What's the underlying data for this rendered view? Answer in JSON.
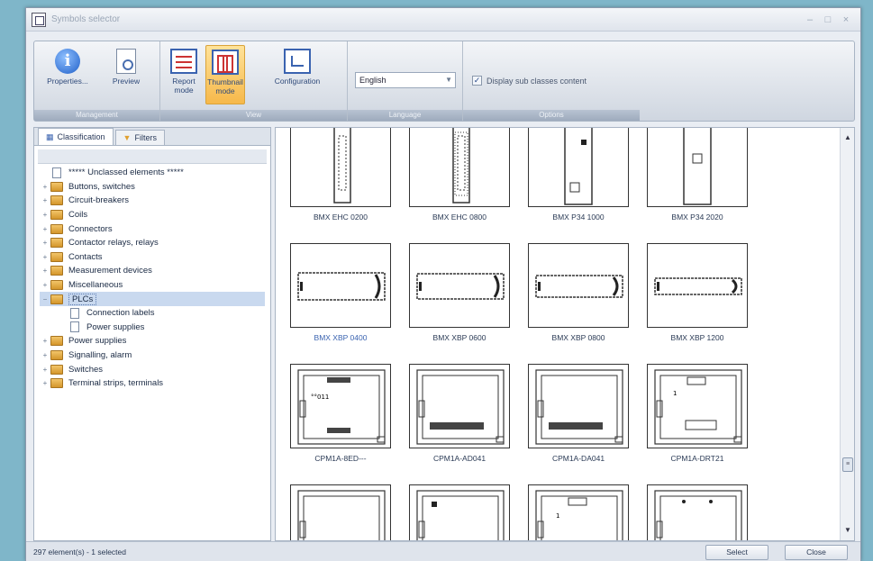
{
  "window": {
    "title": "Symbols selector"
  },
  "ribbon": {
    "buttons": [
      {
        "label": "Properties...",
        "icon": "info-icon"
      },
      {
        "label": "Preview",
        "icon": "preview-icon"
      },
      {
        "label": "Report mode",
        "icon": "report-mode-icon"
      },
      {
        "label": "Thumbnail mode",
        "icon": "thumbnail-mode-icon",
        "active": true
      },
      {
        "label": "Configuration",
        "icon": "configuration-icon"
      }
    ],
    "groups": [
      "Management",
      "View",
      "Language",
      "Options"
    ],
    "language": "English",
    "option_label": "Display sub classes content",
    "option_checked": true
  },
  "tabs": [
    "Classification",
    "Filters"
  ],
  "tree": [
    {
      "label": "***** Unclassed elements *****",
      "type": "doc"
    },
    {
      "label": "Buttons, switches",
      "type": "folder"
    },
    {
      "label": "Circuit-breakers",
      "type": "folder"
    },
    {
      "label": "Coils",
      "type": "folder"
    },
    {
      "label": "Connectors",
      "type": "folder"
    },
    {
      "label": "Contactor relays, relays",
      "type": "folder"
    },
    {
      "label": "Contacts",
      "type": "folder"
    },
    {
      "label": "Measurement devices",
      "type": "folder"
    },
    {
      "label": "Miscellaneous",
      "type": "folder"
    },
    {
      "label": "PLCs",
      "type": "folder",
      "expanded": true,
      "selected": true
    },
    {
      "label": "Connection labels",
      "type": "child"
    },
    {
      "label": "Power supplies",
      "type": "child"
    },
    {
      "label": "Power supplies",
      "type": "folder"
    },
    {
      "label": "Signalling, alarm",
      "type": "folder"
    },
    {
      "label": "Switches",
      "type": "folder"
    },
    {
      "label": "Terminal strips, terminals",
      "type": "folder"
    }
  ],
  "thumbnails": [
    {
      "label": "BMX EHC 0200"
    },
    {
      "label": "BMX EHC 0800"
    },
    {
      "label": "BMX P34 1000"
    },
    {
      "label": "BMX P34 2020"
    },
    {
      "label": "BMX XBP 0400",
      "selected": true
    },
    {
      "label": "BMX XBP 0600"
    },
    {
      "label": "BMX XBP 0800"
    },
    {
      "label": "BMX XBP 1200"
    },
    {
      "label": "CPM1A-8ED---"
    },
    {
      "label": "CPM1A-AD041"
    },
    {
      "label": "CPM1A-DA041"
    },
    {
      "label": "CPM1A-DRT21"
    },
    {
      "label": ""
    },
    {
      "label": ""
    },
    {
      "label": ""
    },
    {
      "label": ""
    }
  ],
  "status": {
    "text": "297 element(s) - 1 selected",
    "select_label": "Select",
    "close_label": "Close"
  },
  "colors": {
    "accent": "#f6b84a",
    "selection": "#c9d9ef",
    "background": "#7fb6c9"
  }
}
